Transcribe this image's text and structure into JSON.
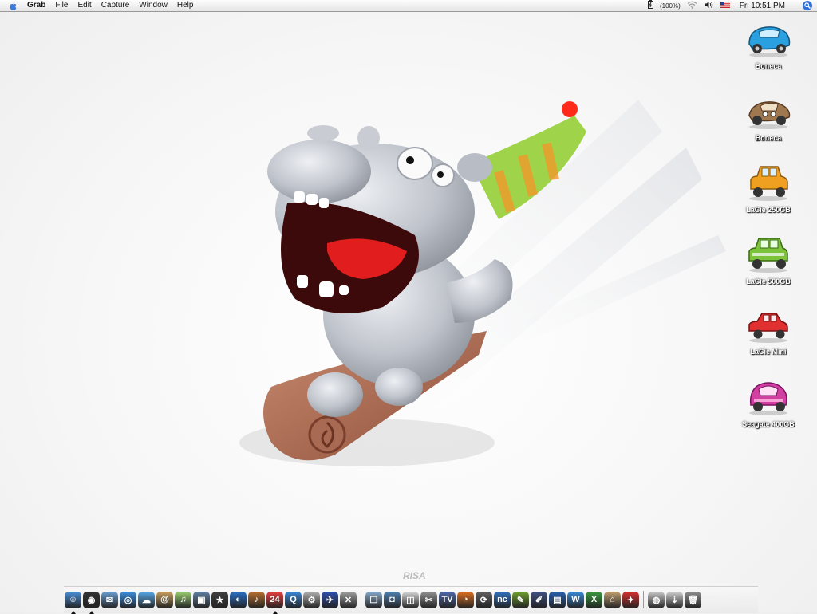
{
  "menubar": {
    "app_name": "Grab",
    "menus": [
      "File",
      "Edit",
      "Capture",
      "Window",
      "Help"
    ],
    "battery": "(100%)",
    "clock": "Fri 10:51 PM",
    "icons": [
      "apple-icon",
      "battery-icon",
      "wifi-icon",
      "volume-icon",
      "us-flag-icon",
      "spotlight-icon"
    ]
  },
  "desktop_icons": [
    {
      "label": "Boneca",
      "icon": "blue-car",
      "color": "#2aa0e0"
    },
    {
      "label": "Boneca",
      "icon": "brown-car",
      "color": "#a07850"
    },
    {
      "label": "LaCie 250GB",
      "icon": "orange-car",
      "color": "#f0a020"
    },
    {
      "label": "LaCie 500GB",
      "icon": "green-car",
      "color": "#7cc23a"
    },
    {
      "label": "LaCie Mini",
      "icon": "red-car",
      "color": "#e03030"
    },
    {
      "label": "Seagate 400GB",
      "icon": "pink-car",
      "color": "#d040a0"
    }
  ],
  "dock": {
    "logo": "RISA",
    "items": [
      {
        "name": "finder",
        "color": "#4a8fd8",
        "glyph": "☺",
        "running": true
      },
      {
        "name": "dashboard",
        "color": "#333333",
        "glyph": "◉",
        "running": true
      },
      {
        "name": "mail",
        "color": "#6a9fd0",
        "glyph": "✉",
        "running": false
      },
      {
        "name": "safari",
        "color": "#3d8fe0",
        "glyph": "◎",
        "running": false
      },
      {
        "name": "ichat",
        "color": "#58a8e8",
        "glyph": "☁",
        "running": false
      },
      {
        "name": "address-book",
        "color": "#c8a060",
        "glyph": "@",
        "running": false
      },
      {
        "name": "itunes",
        "color": "#9cd070",
        "glyph": "♫",
        "running": false
      },
      {
        "name": "iphoto",
        "color": "#6080a0",
        "glyph": "▣",
        "running": false
      },
      {
        "name": "imovie",
        "color": "#404040",
        "glyph": "★",
        "running": false
      },
      {
        "name": "idvd",
        "color": "#2a70c8",
        "glyph": "◐",
        "running": false
      },
      {
        "name": "garageband",
        "color": "#b87030",
        "glyph": "♪",
        "running": false
      },
      {
        "name": "ical",
        "color": "#e84040",
        "glyph": "24",
        "running": true
      },
      {
        "name": "quicktime",
        "color": "#3a88d8",
        "glyph": "Q",
        "running": false
      },
      {
        "name": "system-prefs",
        "color": "#b0b0b0",
        "glyph": "⚙",
        "running": false
      },
      {
        "name": "xcode",
        "color": "#3050b0",
        "glyph": "✈",
        "running": false
      },
      {
        "name": "utilities",
        "color": "#a0a0a0",
        "glyph": "✕",
        "running": false
      },
      {
        "name": "sep-1",
        "color": "",
        "glyph": "|",
        "running": true
      },
      {
        "name": "preview",
        "color": "#88aacc",
        "glyph": "❐",
        "running": false
      },
      {
        "name": "photo-booth",
        "color": "#5080b0",
        "glyph": "◘",
        "running": false
      },
      {
        "name": "ipod",
        "color": "#d8d8d8",
        "glyph": "◫",
        "running": false
      },
      {
        "name": "scissors",
        "color": "#909090",
        "glyph": "✂",
        "running": false
      },
      {
        "name": "tv",
        "color": "#5068a8",
        "glyph": "TV",
        "running": false
      },
      {
        "name": "firefox",
        "color": "#e07020",
        "glyph": "◔",
        "running": false
      },
      {
        "name": "sync",
        "color": "#606060",
        "glyph": "⟳",
        "running": false
      },
      {
        "name": "nc",
        "color": "#3070c0",
        "glyph": "nc",
        "running": false
      },
      {
        "name": "pen",
        "color": "#70a030",
        "glyph": "✎",
        "running": false
      },
      {
        "name": "brush",
        "color": "#405080",
        "glyph": "✐",
        "running": false
      },
      {
        "name": "keynote",
        "color": "#2a60b0",
        "glyph": "▤",
        "running": false
      },
      {
        "name": "word",
        "color": "#3a8ad8",
        "glyph": "W",
        "running": false
      },
      {
        "name": "excel",
        "color": "#3a9a40",
        "glyph": "X",
        "running": false
      },
      {
        "name": "home",
        "color": "#c0a070",
        "glyph": "⌂",
        "running": false
      },
      {
        "name": "acrobat",
        "color": "#d83030",
        "glyph": "✦",
        "running": false
      },
      {
        "name": "sep-2",
        "color": "",
        "glyph": "",
        "running": false
      },
      {
        "name": "webcam",
        "color": "#c8c8c8",
        "glyph": "◍",
        "running": false
      },
      {
        "name": "downloads",
        "color": "#d0d0d0",
        "glyph": "⇣",
        "running": false
      },
      {
        "name": "trash",
        "color": "#909090",
        "glyph": "🗑",
        "running": false
      }
    ]
  }
}
